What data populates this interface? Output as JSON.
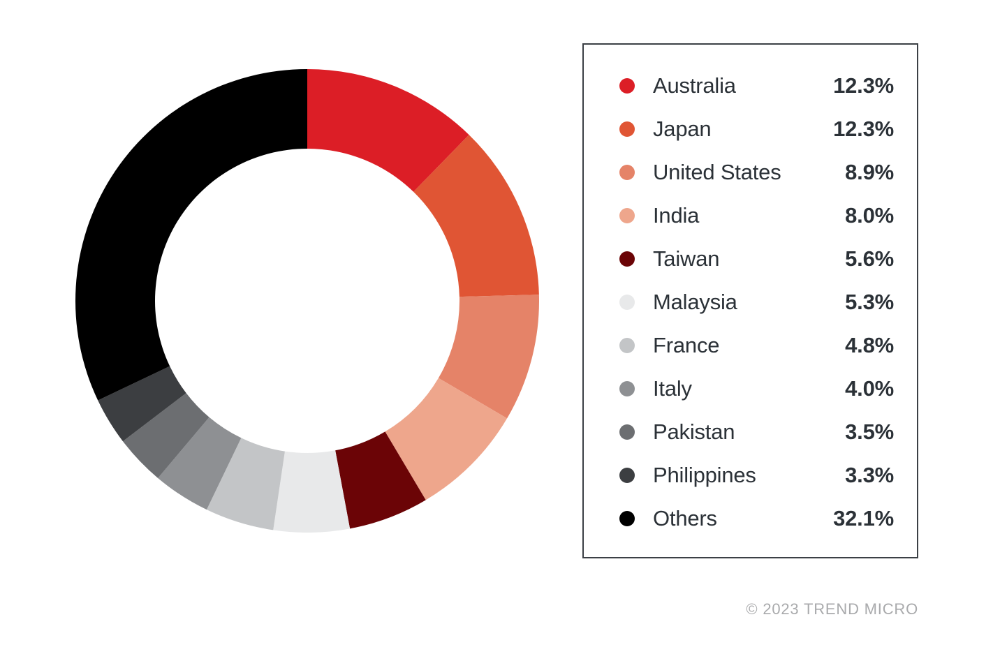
{
  "chart_data": {
    "type": "pie",
    "variant": "donut",
    "title": "",
    "subtitle": "",
    "xlabel": "",
    "ylabel": "",
    "legend_position": "right",
    "grid": false,
    "unit": "%",
    "start_angle_deg": 0,
    "direction": "clockwise",
    "categories": [
      "Australia",
      "Japan",
      "United States",
      "India",
      "Taiwan",
      "Malaysia",
      "France",
      "Italy",
      "Pakistan",
      "Philippines",
      "Others"
    ],
    "values": [
      12.3,
      12.3,
      8.9,
      8.0,
      5.6,
      5.3,
      4.8,
      4.0,
      3.5,
      3.3,
      32.1
    ],
    "value_labels": [
      "12.3%",
      "12.3%",
      "8.9%",
      "8.0%",
      "5.6%",
      "5.3%",
      "4.8%",
      "4.0%",
      "3.5%",
      "3.3%",
      "32.1%"
    ],
    "colors": [
      "#DC1E26",
      "#E05534",
      "#E58368",
      "#EEA68C",
      "#6B0406",
      "#E8E9EA",
      "#C3C5C7",
      "#8E9093",
      "#6C6E71",
      "#3C3E41",
      "#000000"
    ],
    "slices": [
      {
        "label": "Australia",
        "value": 12.3,
        "value_label": "12.3%",
        "color": "#DC1E26"
      },
      {
        "label": "Japan",
        "value": 12.3,
        "value_label": "12.3%",
        "color": "#E05534"
      },
      {
        "label": "United States",
        "value": 8.9,
        "value_label": "8.9%",
        "color": "#E58368"
      },
      {
        "label": "India",
        "value": 8.0,
        "value_label": "8.0%",
        "color": "#EEA68C"
      },
      {
        "label": "Taiwan",
        "value": 5.6,
        "value_label": "5.6%",
        "color": "#6B0406"
      },
      {
        "label": "Malaysia",
        "value": 5.3,
        "value_label": "5.3%",
        "color": "#E8E9EA"
      },
      {
        "label": "France",
        "value": 4.8,
        "value_label": "4.8%",
        "color": "#C3C5C7"
      },
      {
        "label": "Italy",
        "value": 4.0,
        "value_label": "4.0%",
        "color": "#8E9093"
      },
      {
        "label": "Pakistan",
        "value": 3.5,
        "value_label": "3.5%",
        "color": "#6C6E71"
      },
      {
        "label": "Philippines",
        "value": 3.3,
        "value_label": "3.3%",
        "color": "#3C3E41"
      },
      {
        "label": "Others",
        "value": 32.1,
        "value_label": "32.1%",
        "color": "#000000"
      }
    ]
  },
  "legend": {
    "items": [
      {
        "label": "Australia",
        "value": "12.3%",
        "color": "#DC1E26"
      },
      {
        "label": "Japan",
        "value": "12.3%",
        "color": "#E05534"
      },
      {
        "label": "United States",
        "value": "8.9%",
        "color": "#E58368"
      },
      {
        "label": "India",
        "value": "8.0%",
        "color": "#EEA68C"
      },
      {
        "label": "Taiwan",
        "value": "5.6%",
        "color": "#6B0406"
      },
      {
        "label": "Malaysia",
        "value": "5.3%",
        "color": "#E8E9EA"
      },
      {
        "label": "France",
        "value": "4.8%",
        "color": "#C3C5C7"
      },
      {
        "label": "Italy",
        "value": "4.0%",
        "color": "#8E9093"
      },
      {
        "label": "Pakistan",
        "value": "3.5%",
        "color": "#6C6E71"
      },
      {
        "label": "Philippines",
        "value": "3.3%",
        "color": "#3C3E41"
      },
      {
        "label": "Others",
        "value": "32.1%",
        "color": "#000000"
      }
    ]
  },
  "footer": {
    "copyright": "© 2023 TREND MICRO"
  }
}
